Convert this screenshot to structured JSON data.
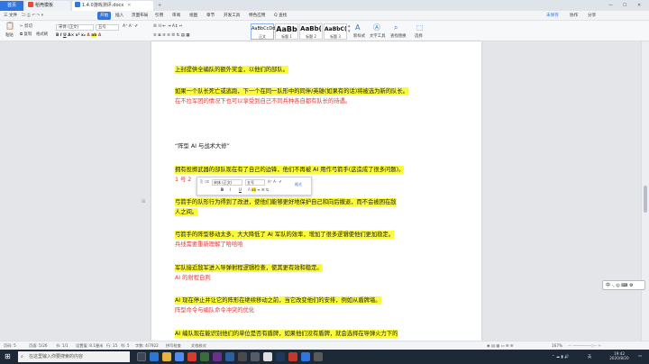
{
  "tabs": {
    "home": "首页",
    "template": "稻壳模板",
    "doc": "1.4.0游戏测评.docx"
  },
  "menu": {
    "file": "三 文件",
    "start": "开始",
    "items": [
      "插入",
      "页面布局",
      "引用",
      "审阅",
      "视图",
      "章节",
      "开发工具",
      "特色应用"
    ],
    "search": "Q 查找",
    "right": [
      "未保存",
      "协作",
      "分享"
    ]
  },
  "ribbon": {
    "paste": "粘贴",
    "cut": "剪切",
    "copy": "复制",
    "format_brush": "格式刷",
    "font_name": "宋体 (正文)",
    "font_size": "五号",
    "styles": [
      {
        "preview": "AaBbCcDd",
        "label": "正文"
      },
      {
        "preview": "AaBb",
        "label": "标题 1"
      },
      {
        "preview": "AaBb(",
        "label": "标题 2"
      },
      {
        "preview": "AaBbC(",
        "label": "标题 3"
      }
    ],
    "new_style": "新样式",
    "text_tools": "文字工具",
    "find_replace": "查找替换",
    "select": "选择"
  },
  "document": {
    "lines": [
      {
        "text": "上封提供全编队的额外奖金，以他们的部队。",
        "style": "hl"
      },
      {
        "text": "如果一个队长死亡或逃跑，下一个在同一队形中的同伴/英雄(如果有的话)将被选为新的队长。",
        "style": "hl"
      },
      {
        "text": "在不拉军团的情况下也可以享受到自己不同兵种各自都有队长的待遇。",
        "style": "red"
      },
      {
        "text": "“阵型 AI 与战术大修”",
        "style": "dark"
      },
      {
        "text": "拥有投掷武器的部队现在有了自己的边锋，他们不再被 AI 用作弓箭手(这造成了很多问题)。",
        "style": "hl"
      },
      {
        "text": "1 号 2",
        "style": "red"
      },
      {
        "text": "弓箭手的队形行为得到了改进，使他们能够更好地保护自己和向后撤退，而不会被困在敌",
        "style": "hl"
      },
      {
        "text": "人之间。",
        "style": "hl"
      },
      {
        "text": "弓箭手的阵型移动太多，大大降低了 AI 军队的效率，增加了很多逻辑使他们更加稳定。",
        "style": "hl"
      },
      {
        "text": "兵线需要重新理解了哈哈哈",
        "style": "red"
      },
      {
        "text": "军队接近敌军进入导弹射程逻辑检查，使其更有效和稳定。",
        "style": "hl"
      },
      {
        "text": "AI 的射程自判",
        "style": "red"
      },
      {
        "text": "AI 现在停止并让它的阵形在继续移动之前，当它改变他们的安排，例如从盾牌墙。",
        "style": "hl"
      },
      {
        "text": "阵型命令与编队命令冲突的优化",
        "style": "red"
      },
      {
        "text": "AI 编队现在能识别他们的单位是否有盾牌，如果他们没有盾牌，就会选择在导弹火力下的",
        "style": "hl"
      }
    ]
  },
  "mini_toolbar": {
    "font": "宋体 (正文)",
    "size": "五号",
    "bold": "B",
    "italic": "I",
    "underline": "U",
    "more": "格式"
  },
  "ime": "中 ·, ◎ ⌨ ⚙",
  "status": {
    "page": "页码: 5",
    "pages": "页面: 5/26",
    "section": "节: 1/1",
    "setting": "设置值: 8.1厘米",
    "row": "行: 15",
    "col": "列: 5",
    "words": "字数: 4/7922",
    "spell": "拼写检查",
    "doc_check": "文档校对",
    "zoom": "167%"
  },
  "taskbar": {
    "search_placeholder": "在这里输入你要搜索的内容",
    "time": "19:42",
    "date": "2020/8/20",
    "lang": "英"
  },
  "colors": {
    "accent": "#2f76e0",
    "highlight": "#fbfb3a",
    "red_text": "#e53935"
  }
}
